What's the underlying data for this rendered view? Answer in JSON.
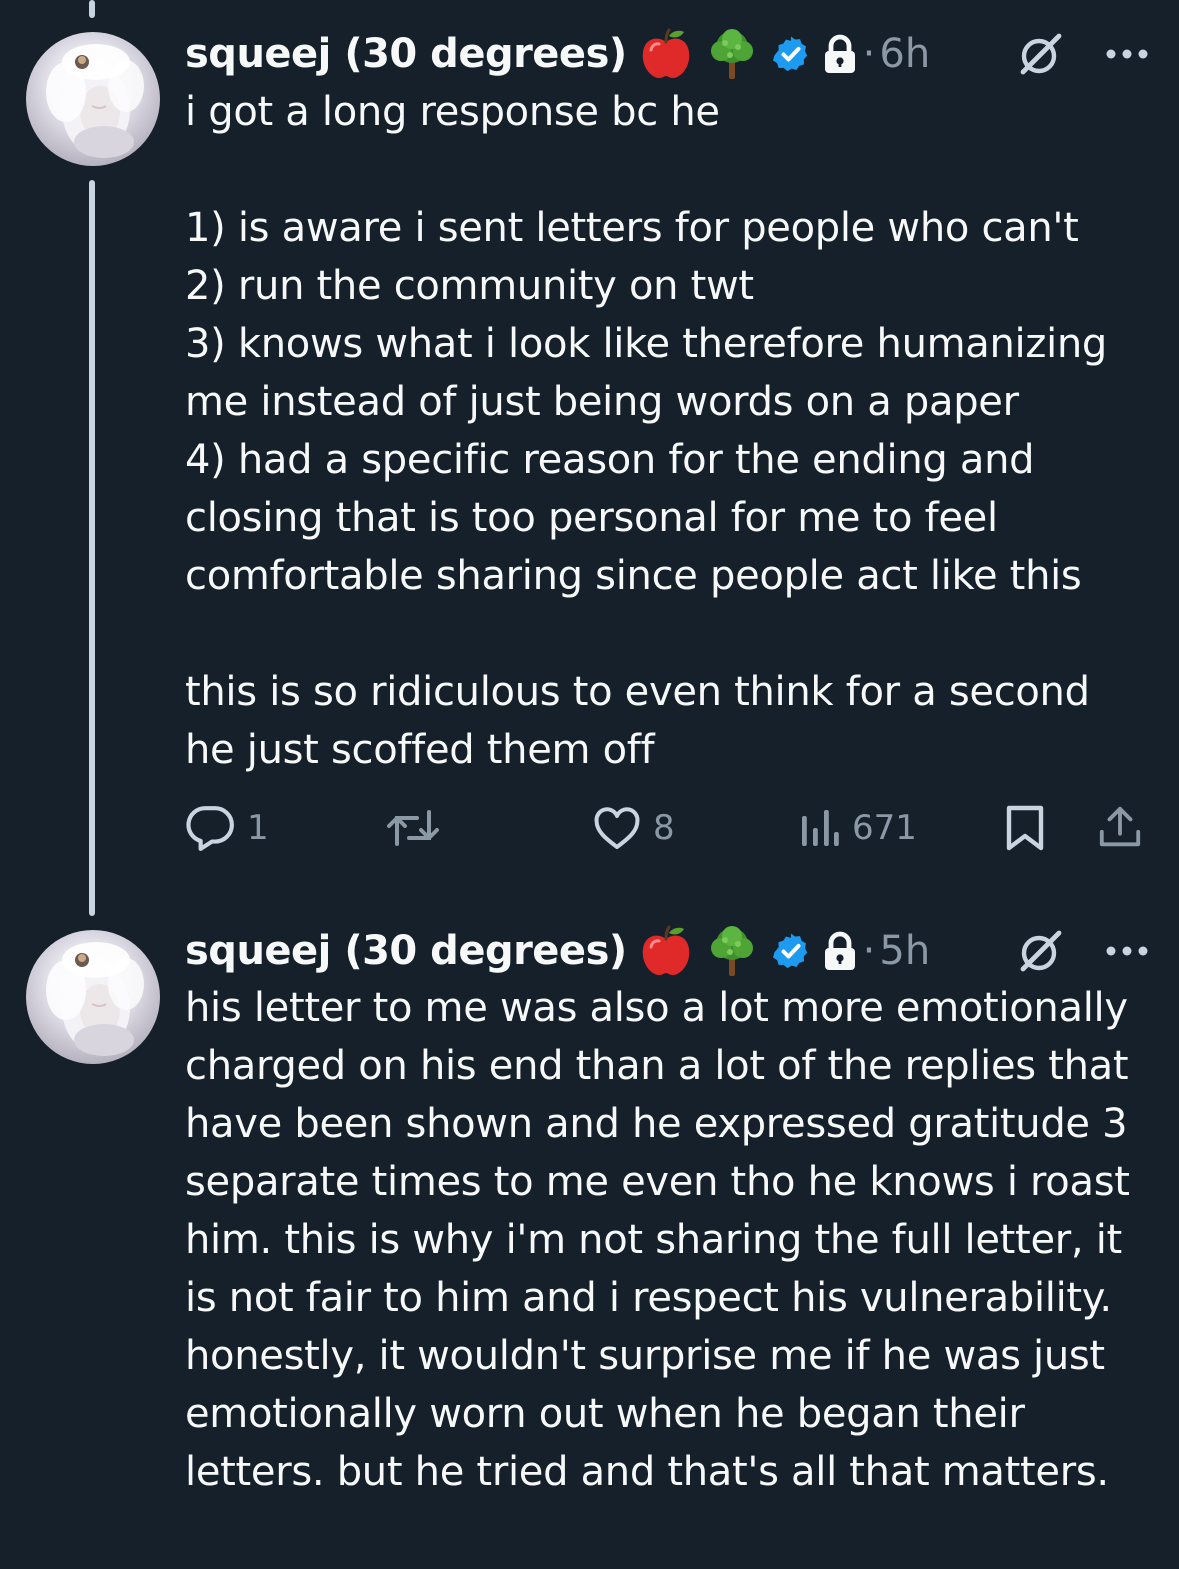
{
  "tweets": [
    {
      "display_name": "squeej (30 degrees)",
      "time": "6h",
      "separator": "·",
      "text": "i got a long response bc he\n\n1) is aware i sent letters for people who can't\n2) run the community on twt\n3) knows what i look like therefore humanizing me instead of just being words on a paper\n4) had a specific reason for the ending and closing that is too personal for me to feel comfortable sharing since people act like this\n\nthis is so ridiculous to even think for a second he just scoffed them off",
      "replies": "1",
      "likes": "8",
      "views": "671"
    },
    {
      "display_name": "squeej (30 degrees)",
      "time": "5h",
      "separator": "·",
      "text": "his letter to me was also a lot more emotionally charged on his end than a lot of the replies that have been shown and he expressed gratitude 3 separate times to me even tho he knows i roast him. this is why i'm not sharing the full letter, it is not fair to him and i respect his vulnerability. honestly, it wouldn't surprise me if he was just emotionally worn out when he began their letters. but he tried and that's all that matters."
    }
  ],
  "icons": {
    "emoji_1": "red-apple-emoji",
    "emoji_2": "deciduous-tree-emoji",
    "verified": "verified-badge-icon",
    "protected": "lock-icon",
    "grok": "grok-icon",
    "more": "more-icon",
    "reply": "reply-icon",
    "retweet": "retweet-icon",
    "like": "heart-icon",
    "views": "views-icon",
    "bookmark": "bookmark-icon",
    "share": "share-icon"
  },
  "colors": {
    "background": "#15202b",
    "text": "#f7f9f9",
    "secondary": "#8b98a5",
    "verified": "#1d9bf0",
    "thread_line": "#c8d4df"
  }
}
